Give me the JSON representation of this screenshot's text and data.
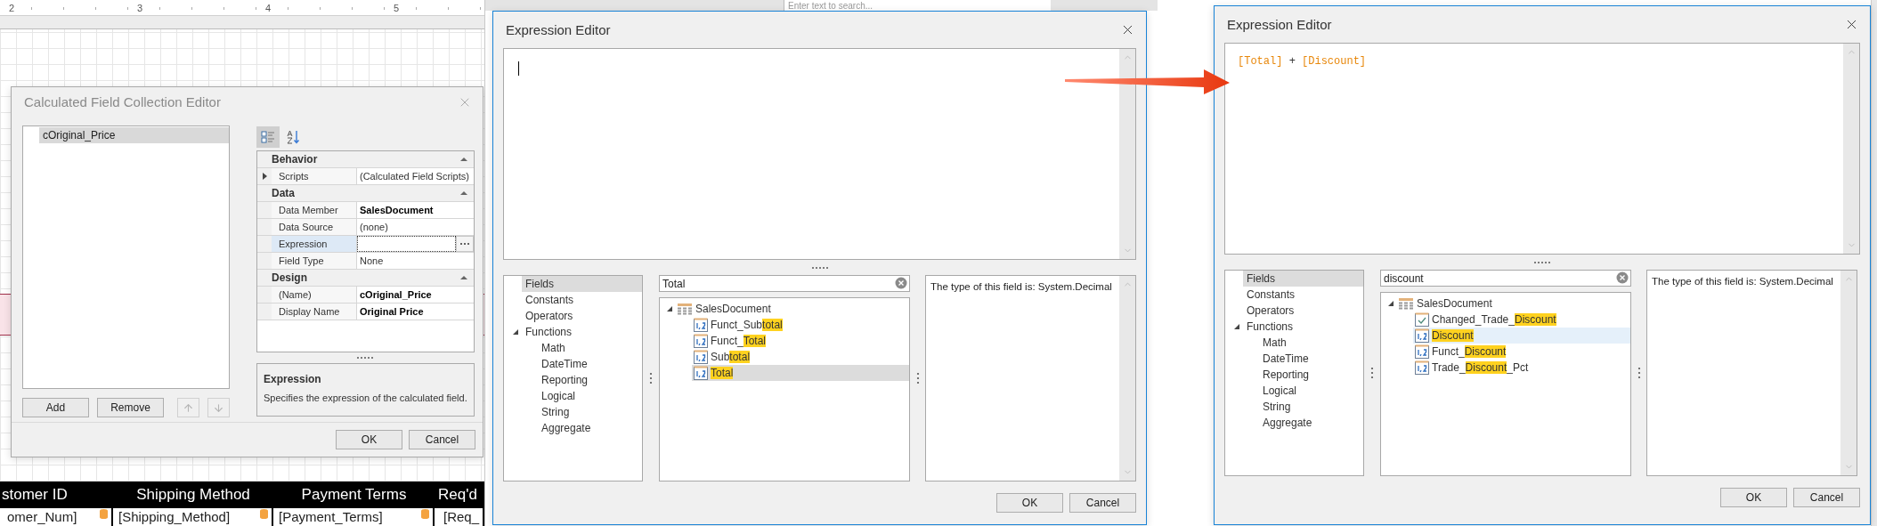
{
  "designer": {
    "ruler": [
      "2",
      "3",
      "4",
      "5"
    ],
    "table_headers": [
      "stomer ID",
      "Shipping Method",
      "Payment Terms",
      "Req'd"
    ],
    "table_cells": [
      "omer_Num]",
      "[Shipping_Method]",
      "[Payment_Terms]",
      "[Req_"
    ],
    "search_placeholder": "Enter text to search..."
  },
  "calc_dialog": {
    "title": "Calculated Field Collection Editor",
    "list_items": [
      {
        "label": "cOriginal_Price",
        "selected": true
      }
    ],
    "toolbar": [
      {
        "kind": "categorized",
        "selected": true
      },
      {
        "kind": "alphabetical",
        "selected": false
      }
    ],
    "categories": [
      {
        "name": "Behavior",
        "expanded": true,
        "properties": [
          {
            "name": "Scripts",
            "value": "(Calculated Field Scripts)",
            "kind": "text",
            "modified": false,
            "selected": false,
            "expanded": false
          }
        ]
      },
      {
        "name": "Data",
        "expanded": true,
        "properties": [
          {
            "name": "Data Member",
            "value": "SalesDocument",
            "kind": "text",
            "modified": true,
            "selected": false
          },
          {
            "name": "Data Source",
            "value": "(none)",
            "kind": "text",
            "modified": false,
            "selected": false
          },
          {
            "name": "Expression",
            "kind": "editor",
            "selected": true
          },
          {
            "name": "Field Type",
            "value": "None",
            "kind": "text",
            "modified": false,
            "selected": false
          }
        ]
      },
      {
        "name": "Design",
        "expanded": true,
        "properties": [
          {
            "name": "(Name)",
            "value": "cOriginal_Price",
            "kind": "text",
            "modified": true,
            "selected": false
          },
          {
            "name": "Display Name",
            "value": "Original Price",
            "kind": "text",
            "modified": true,
            "selected": false
          }
        ]
      }
    ],
    "description": {
      "title": "Expression",
      "text": "Specifies the expression of the calculated field."
    },
    "buttons": [
      "Add",
      "Remove"
    ],
    "move_buttons": [
      {
        "kind": "up",
        "disabled": true
      },
      {
        "kind": "down",
        "disabled": true
      }
    ],
    "ok": "OK",
    "cancel": "Cancel"
  },
  "editors": [
    {
      "title": "Expression Editor",
      "search": "Total",
      "categories": [
        {
          "label": "Fields",
          "selected": true
        },
        {
          "label": "Constants",
          "selected": false
        },
        {
          "label": "Operators",
          "selected": false
        },
        {
          "label": "Functions",
          "selected": false,
          "expanded": true,
          "children": [
            {
              "label": "Math",
              "selected": false
            },
            {
              "label": "DateTime",
              "selected": false
            },
            {
              "label": "Reporting",
              "selected": false
            },
            {
              "label": "Logical",
              "selected": false
            },
            {
              "label": "String",
              "selected": false
            },
            {
              "label": "Aggregate",
              "selected": false
            }
          ]
        }
      ],
      "tree": {
        "root": "SalesDocument",
        "expanded": true,
        "items": [
          {
            "kind": "number",
            "selected": false,
            "hovered": false,
            "parts": [
              {
                "text": "Funct_Sub",
                "match": false
              },
              {
                "text": "total",
                "match": true
              }
            ]
          },
          {
            "kind": "number",
            "selected": false,
            "hovered": false,
            "parts": [
              {
                "text": "Funct_",
                "match": false
              },
              {
                "text": "Total",
                "match": true
              }
            ]
          },
          {
            "kind": "number",
            "selected": false,
            "hovered": false,
            "parts": [
              {
                "text": "Sub",
                "match": false
              },
              {
                "text": "total",
                "match": true
              }
            ]
          },
          {
            "kind": "number",
            "selected": true,
            "hovered": false,
            "parts": [
              {
                "text": "Total",
                "match": true
              }
            ]
          }
        ]
      },
      "info": "The type of this field is: System.Decimal",
      "ok": "OK",
      "cancel": "Cancel"
    },
    {
      "title": "Expression Editor",
      "search": "discount",
      "expression": [
        {
          "text": "[Total]",
          "kind": "field"
        },
        {
          "text": "+",
          "kind": "operator"
        },
        {
          "text": "[Discount]",
          "kind": "field"
        }
      ],
      "categories": [
        {
          "label": "Fields",
          "selected": true
        },
        {
          "label": "Constants",
          "selected": false
        },
        {
          "label": "Operators",
          "selected": false
        },
        {
          "label": "Functions",
          "selected": false,
          "expanded": true,
          "children": [
            {
              "label": "Math",
              "selected": false
            },
            {
              "label": "DateTime",
              "selected": false
            },
            {
              "label": "Reporting",
              "selected": false
            },
            {
              "label": "Logical",
              "selected": false
            },
            {
              "label": "String",
              "selected": false
            },
            {
              "label": "Aggregate",
              "selected": false
            }
          ]
        }
      ],
      "tree": {
        "root": "SalesDocument",
        "expanded": true,
        "items": [
          {
            "kind": "boolean",
            "selected": false,
            "hovered": false,
            "parts": [
              {
                "text": "Changed_Trade_",
                "match": false
              },
              {
                "text": "Discount",
                "match": true
              }
            ]
          },
          {
            "kind": "number",
            "selected": false,
            "hovered": true,
            "parts": [
              {
                "text": "Discount",
                "match": true
              }
            ]
          },
          {
            "kind": "number",
            "selected": false,
            "hovered": false,
            "parts": [
              {
                "text": "Funct_",
                "match": false
              },
              {
                "text": "Discount",
                "match": true
              }
            ]
          },
          {
            "kind": "number",
            "selected": false,
            "hovered": false,
            "parts": [
              {
                "text": "Trade_",
                "match": false
              },
              {
                "text": "Discount",
                "match": true
              },
              {
                "text": "_Pct",
                "match": false
              }
            ]
          }
        ]
      },
      "info": "The type of this field is: System.Decimal",
      "ok": "OK",
      "cancel": "Cancel"
    }
  ]
}
